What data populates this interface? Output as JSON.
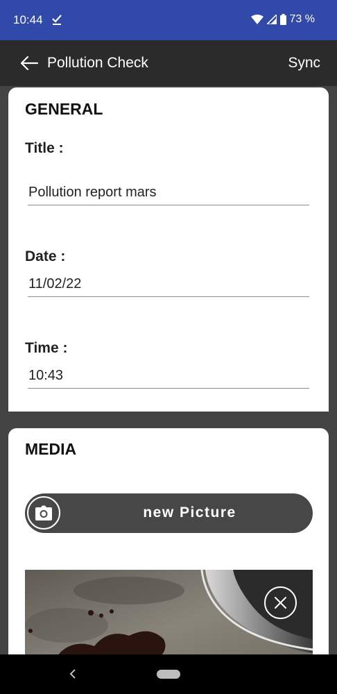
{
  "status_bar": {
    "time": "10:44",
    "battery": "73 %",
    "icons": [
      "task-done-icon",
      "wifi-icon",
      "signal-icon",
      "battery-icon"
    ]
  },
  "app_bar": {
    "title": "Pollution Check",
    "sync_label": "Sync",
    "back_icon": "arrow-left-icon"
  },
  "general": {
    "section_title": "GENERAL",
    "title_label": "Title :",
    "title_value": "Pollution report mars",
    "date_label": "Date :",
    "date_value": "11/02/22",
    "time_label": "Time :",
    "time_value": "10:43"
  },
  "media": {
    "section_title": "MEDIA",
    "new_picture_label": "new Picture",
    "camera_icon": "camera-icon",
    "remove_icon": "close-icon"
  },
  "colors": {
    "status_bar": "#3149a8",
    "app_bar": "#2b2b2b",
    "background": "#444444",
    "button": "#474747"
  }
}
